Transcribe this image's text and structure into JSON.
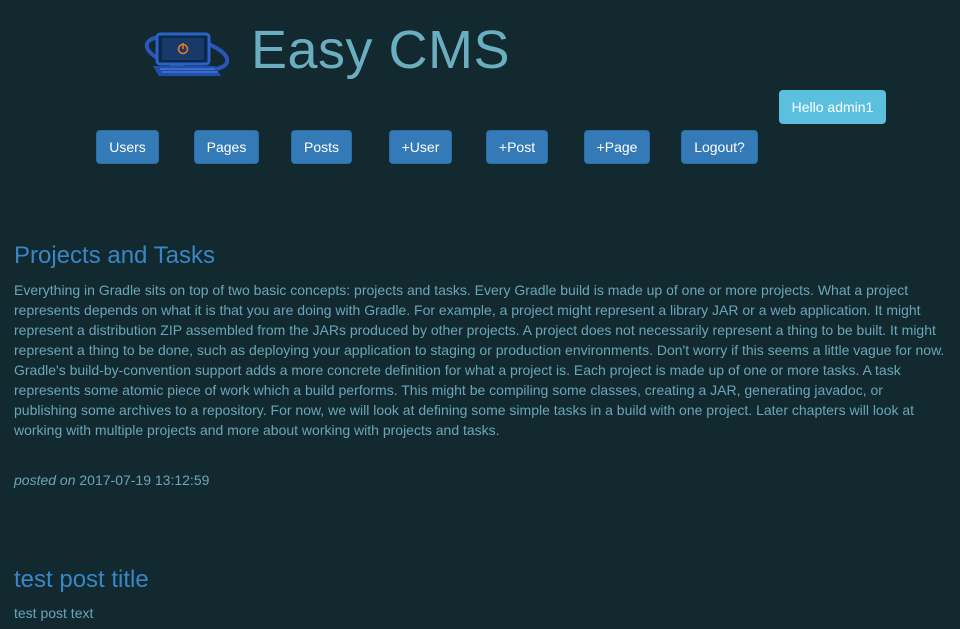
{
  "header": {
    "brand": "Easy CMS",
    "greeting": "Hello admin1"
  },
  "nav": {
    "items": [
      {
        "label": "Users"
      },
      {
        "label": "Pages"
      },
      {
        "label": "Posts"
      },
      {
        "label": "+User"
      },
      {
        "label": "+Post"
      },
      {
        "label": "+Page"
      },
      {
        "label": "Logout?"
      }
    ]
  },
  "posts": [
    {
      "title": "Projects and Tasks",
      "body": "Everything in Gradle sits on top of two basic concepts: projects and tasks. Every Gradle build is made up of one or more projects. What a project represents depends on what it is that you are doing with Gradle. For example, a project might represent a library JAR or a web application. It might represent a distribution ZIP assembled from the JARs produced by other projects. A project does not necessarily represent a thing to be built. It might represent a thing to be done, such as deploying your application to staging or production environments. Don't worry if this seems a little vague for now. Gradle's build-by-convention support adds a more concrete definition for what a project is. Each project is made up of one or more tasks. A task represents some atomic piece of work which a build performs. This might be compiling some classes, creating a JAR, generating javadoc, or publishing some archives to a repository. For now, we will look at defining some simple tasks in a build with one project. Later chapters will look at working with multiple projects and more about working with projects and tasks.",
      "posted_label": "posted on",
      "posted_date": "2017-07-19 13:12:59"
    },
    {
      "title": "test post title",
      "body": "test post text"
    }
  ],
  "colors": {
    "background": "#11292f",
    "brand": "#6aaec0",
    "nav_button": "#337ab7",
    "greeting_badge": "#5bc0de",
    "post_title": "#3a86c5",
    "text": "#6aa6b8"
  }
}
